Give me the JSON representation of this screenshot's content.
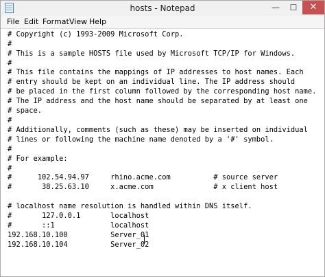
{
  "window": {
    "title": "hosts - Notepad",
    "controls": {
      "minimize": "—",
      "maximize": "☐",
      "close": "✕"
    }
  },
  "menu": [
    "File",
    "Edit",
    "Format",
    "View",
    "Help"
  ],
  "editor": {
    "lines": [
      "# Copyright (c) 1993-2009 Microsoft Corp.",
      "#",
      "# This is a sample HOSTS file used by Microsoft TCP/IP for Windows.",
      "#",
      "# This file contains the mappings of IP addresses to host names. Each",
      "# entry should be kept on an individual line. The IP address should",
      "# be placed in the first column followed by the corresponding host name.",
      "# The IP address and the host name should be separated by at least one",
      "# space.",
      "#",
      "# Additionally, comments (such as these) may be inserted on individual",
      "# lines or following the machine name denoted by a '#' symbol.",
      "#",
      "# For example:",
      "#",
      "#      102.54.94.97     rhino.acme.com          # source server",
      "#       38.25.63.10     x.acme.com              # x client host",
      "",
      "# localhost name resolution is handled within DNS itself.",
      "#       127.0.0.1       localhost",
      "#       ::1             localhost",
      "192.168.10.100          Server_01",
      "192.168.10.104          Server_02"
    ]
  }
}
